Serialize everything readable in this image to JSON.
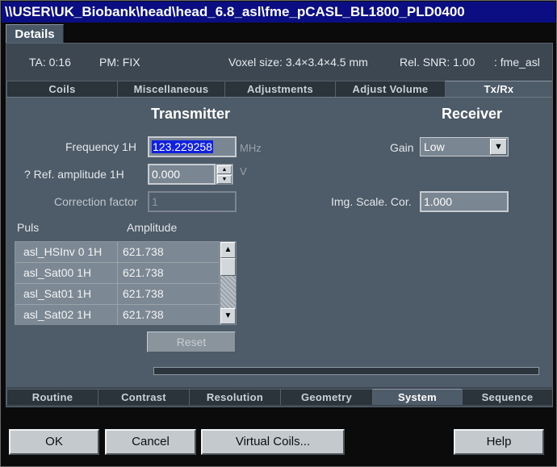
{
  "window": {
    "title": "\\\\USER\\UK_Biobank\\head\\head_6.8_asl\\fme_pCASL_BL1800_PLD0400"
  },
  "top_tab": "Details",
  "info": {
    "ta": "TA: 0:16",
    "pm": "PM: FIX",
    "voxel": "Voxel size: 3.4×3.4×4.5 mm",
    "snr": "Rel. SNR: 1.00",
    "seq": ": fme_asl"
  },
  "upper_tabs": [
    {
      "label": "Coils",
      "active": false
    },
    {
      "label": "Miscellaneous",
      "active": false
    },
    {
      "label": "Adjustments",
      "active": false
    },
    {
      "label": "Adjust Volume",
      "active": false
    },
    {
      "label": "Tx/Rx",
      "active": true
    }
  ],
  "transmitter": {
    "heading": "Transmitter",
    "frequency_label": "Frequency 1H",
    "frequency_value": "123.229258",
    "frequency_unit": "MHz",
    "ref_amp_label": "? Ref. amplitude 1H",
    "ref_amp_value": "0.000",
    "ref_amp_unit": "V",
    "correction_label": "Correction factor",
    "correction_value": "1"
  },
  "receiver": {
    "heading": "Receiver",
    "gain_label": "Gain",
    "gain_value": "Low",
    "scale_label": "Img. Scale. Cor.",
    "scale_value": "1.000"
  },
  "pulse_table": {
    "headers": [
      "Puls",
      "Amplitude"
    ],
    "rows": [
      [
        "asl_HSInv 0 1H",
        "621.738"
      ],
      [
        "asl_Sat00 1H",
        "621.738"
      ],
      [
        "asl_Sat01 1H",
        "621.738"
      ],
      [
        "asl_Sat02 1H",
        "621.738"
      ]
    ]
  },
  "reset_label": "Reset",
  "lower_tabs": [
    {
      "label": "Routine",
      "active": false
    },
    {
      "label": "Contrast",
      "active": false
    },
    {
      "label": "Resolution",
      "active": false
    },
    {
      "label": "Geometry",
      "active": false
    },
    {
      "label": "System",
      "active": true
    },
    {
      "label": "Sequence",
      "active": false
    }
  ],
  "buttons": {
    "ok": "OK",
    "cancel": "Cancel",
    "virtual_coils": "Virtual Coils...",
    "help": "Help"
  },
  "colors": {
    "titlebar": "#0a0e82",
    "panel": "#4e5b68",
    "selection": "#1020e0"
  }
}
